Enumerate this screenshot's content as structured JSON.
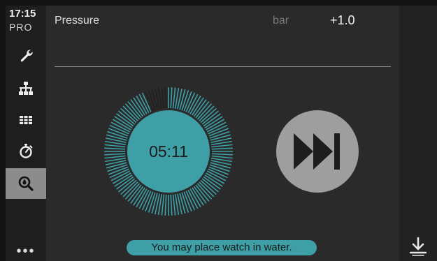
{
  "status": {
    "time": "17:15",
    "edition": "PRO"
  },
  "sidebar": {
    "items": [
      {
        "icon": "wrench-icon"
      },
      {
        "icon": "network-icon"
      },
      {
        "icon": "grid-icon"
      },
      {
        "icon": "stopwatch-icon"
      },
      {
        "icon": "magnifier-drop-icon",
        "active": true
      }
    ],
    "more_label": "•••"
  },
  "param": {
    "label": "Pressure",
    "unit": "bar",
    "value": "+1.0"
  },
  "timer": {
    "time": "05:11",
    "progress_remaining": 0.94
  },
  "banner": {
    "text": "You may place watch in water."
  },
  "colors": {
    "accent": "#3f9fa6",
    "active_nav": "#8c8c8c",
    "button": "#9e9e9e"
  }
}
